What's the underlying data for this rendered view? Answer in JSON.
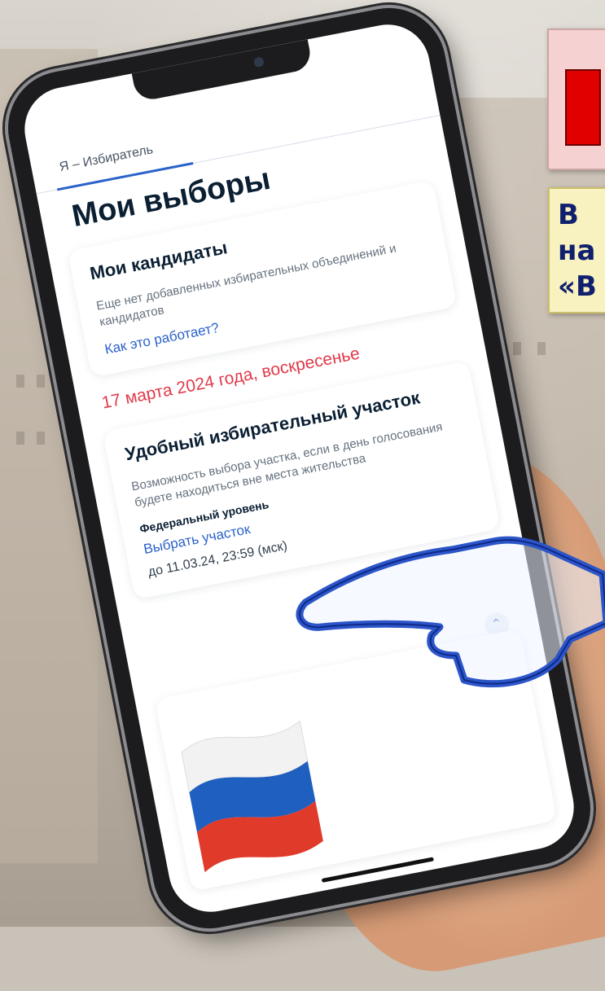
{
  "app": {
    "tab_label": "Я – Избиратель",
    "page_title": "Мои выборы"
  },
  "candidates_card": {
    "title": "Мои кандидаты",
    "text": "Еще нет добавленных избирательных объединений и кандидатов",
    "link": "Как это работает?"
  },
  "election_date": "17 марта 2024 года, воскресенье",
  "polling_station_card": {
    "title": "Удобный избирательный участок",
    "text": "Возможность выбора участка, если в день голосования будете находиться вне места жительства",
    "level_label": "Федеральный уровень",
    "select_link": "Выбрать участок",
    "deadline": "до 11.03.24, 23:59 (мск)",
    "collapse_icon": "chevron-up-icon"
  },
  "callout_right": {
    "lines": [
      "В",
      "на",
      "«В"
    ]
  },
  "colors": {
    "accent": "#2b62c9",
    "date_red": "#e03a4a",
    "callout_red": "#e00000",
    "callout_text": "#10206e"
  }
}
